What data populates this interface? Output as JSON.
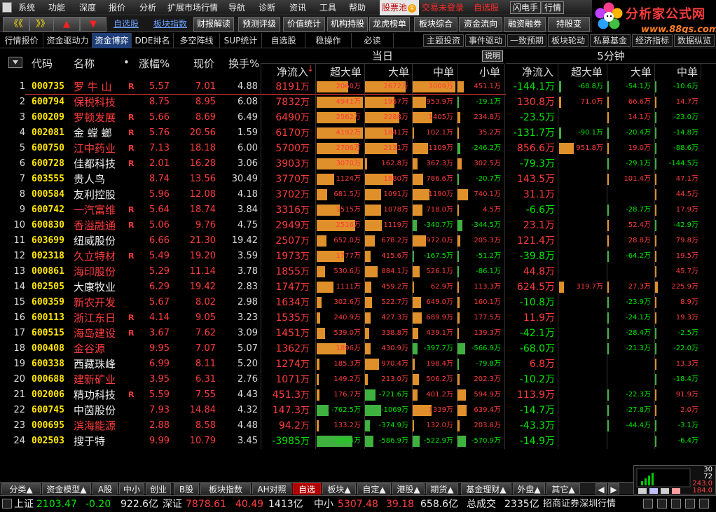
{
  "menubar": {
    "items": [
      "系统",
      "功能",
      "深度",
      "报价",
      "分析",
      "扩展市场行情",
      "导航",
      "诊断",
      "资讯",
      "工具",
      "帮助"
    ],
    "stock_pool": "股票池",
    "stock_pool_badge": "①",
    "login_prompt": "交易未登录",
    "self_select": "自选股",
    "flash_btn": "闪电手",
    "quote_btn": "行情"
  },
  "toolbar": {
    "back": "《《",
    "forward": "》》",
    "up": "▲",
    "down": "▼",
    "links": [
      "自选股",
      "板块指数"
    ],
    "buttons": [
      "财报解读",
      "预测评级",
      "价值统计",
      "机构持股",
      "龙虎榜单",
      "板块综合",
      "资金流向",
      "融资融券",
      "持股变"
    ]
  },
  "logo": {
    "title": "分析家公式网",
    "url": "www.88gs.com"
  },
  "subtabs": {
    "left": [
      "行情报价",
      "资金驱动力",
      "资金博弈",
      "DDE排名",
      "多空阵线",
      "SUP统计",
      "自选股",
      "稳操作",
      "必读"
    ],
    "right": [
      "主题投资",
      "事件驱动",
      "一致预期",
      "板块轮动",
      "私募基金",
      "经济指标",
      "数据纵览"
    ]
  },
  "table_header": {
    "code": "代码",
    "name": "名称",
    "name_dot": "•",
    "change": "涨幅%",
    "price": "现价",
    "turnover": "换手%",
    "group_today": "当日",
    "explain": "说明",
    "group_5min": "5分钟",
    "today_cols": [
      "净流入",
      "超大单",
      "大单",
      "中单",
      "小单"
    ],
    "min_cols": [
      "净流入",
      "超大单",
      "大单",
      "中单"
    ]
  },
  "colors": {
    "up": "#ff3c3c",
    "down": "#00e600",
    "code": "#ffe600",
    "bar_up": "#e0902a",
    "bar_down": "#3fb13f"
  },
  "rows": [
    {
      "idx": "1",
      "code": "000735",
      "name": "罗 牛 山",
      "name_red": true,
      "flag": "R",
      "chg": "5.57",
      "price": "7.01",
      "turn": "4.88",
      "net": "8191",
      "net_unit": "万",
      "t1": "2060万",
      "t2": "2672万",
      "t3": "3009万",
      "t4": "451.1万",
      "net5": "-144.1万",
      "m1": "-68.8万",
      "m2": "-54.1万",
      "m3": "-10.6万"
    },
    {
      "idx": "2",
      "code": "600794",
      "name": "保税科技",
      "name_red": true,
      "flag": "",
      "chg": "8.75",
      "price": "8.95",
      "turn": "6.08",
      "net": "7832",
      "net_unit": "万",
      "t1": "4941万",
      "t2": "1957万",
      "t3": "953.9万",
      "t4": "-19.1万",
      "net5": "130.8万",
      "m1": "71.0万",
      "m2": "66.6万",
      "m3": "14.7万"
    },
    {
      "idx": "3",
      "code": "600209",
      "name": "罗顿发展",
      "name_red": true,
      "flag": "R",
      "chg": "5.66",
      "price": "8.69",
      "turn": "6.49",
      "net": "6490",
      "net_unit": "万",
      "t1": "2562万",
      "t2": "2288万",
      "t3": "1405万",
      "t4": "234.8万",
      "net5": "-23.5万",
      "m1": "",
      "m2": "14.1万",
      "m3": "-23.0万"
    },
    {
      "idx": "4",
      "code": "002081",
      "name": "金 螳 螂",
      "name_red": false,
      "flag": "R",
      "chg": "5.76",
      "price": "20.56",
      "turn": "1.59",
      "net": "6170",
      "net_unit": "万",
      "t1": "4192万",
      "t2": "1841万",
      "t3": "102.1万",
      "t4": "35.2万",
      "net5": "-131.7万",
      "m1": "-90.1万",
      "m2": "-20.4万",
      "m3": "-14.8万"
    },
    {
      "idx": "5",
      "code": "600750",
      "name": "江中药业",
      "name_red": true,
      "flag": "R",
      "chg": "7.13",
      "price": "18.18",
      "turn": "6.00",
      "net": "5700",
      "net_unit": "万",
      "t1": "2706万",
      "t2": "2131万",
      "t3": "1109万",
      "t4": "-246.2万",
      "net5": "856.6万",
      "m1": "951.8万",
      "m2": "19.0万",
      "m3": "-88.6万"
    },
    {
      "idx": "6",
      "code": "600728",
      "name": "佳都科技",
      "name_red": false,
      "flag": "R",
      "chg": "2.01",
      "price": "16.28",
      "turn": "3.06",
      "net": "3903",
      "net_unit": "万",
      "t1": "3070万",
      "t2": "162.8万",
      "t3": "367.3万",
      "t4": "302.5万",
      "net5": "-79.3万",
      "m1": "",
      "m2": "-29.1万",
      "m3": "-144.5万"
    },
    {
      "idx": "7",
      "code": "603555",
      "name": "贵人鸟",
      "name_red": false,
      "flag": "",
      "chg": "8.74",
      "price": "13.56",
      "turn": "30.49",
      "net": "3770",
      "net_unit": "万",
      "t1": "1124万",
      "t2": "1880万",
      "t3": "786.6万",
      "t4": "-20.7万",
      "net5": "143.5万",
      "m1": "",
      "m2": "101.4万",
      "m3": "47.1万"
    },
    {
      "idx": "8",
      "code": "000584",
      "name": "友利控股",
      "name_red": false,
      "flag": "",
      "chg": "5.96",
      "price": "12.08",
      "turn": "4.18",
      "net": "3702",
      "net_unit": "万",
      "t1": "681.5万",
      "t2": "1091万",
      "t3": "1190万",
      "t4": "740.1万",
      "net5": "31.1万",
      "m1": "",
      "m2": "",
      "m3": "44.5万"
    },
    {
      "idx": "9",
      "code": "600742",
      "name": "一汽富维",
      "name_red": true,
      "flag": "R",
      "chg": "5.64",
      "price": "18.74",
      "turn": "3.84",
      "net": "3316",
      "net_unit": "万",
      "t1": "1515万",
      "t2": "1078万",
      "t3": "718.0万",
      "t4": "4.5万",
      "net5": "-6.6万",
      "m1": "",
      "m2": "-28.7万",
      "m3": "17.9万"
    },
    {
      "idx": "10",
      "code": "600830",
      "name": "香溢融通",
      "name_red": true,
      "flag": "R",
      "chg": "5.06",
      "price": "9.76",
      "turn": "4.75",
      "net": "2949",
      "net_unit": "万",
      "t1": "2516万",
      "t2": "1119万",
      "t3": "-340.7万",
      "t4": "-344.5万",
      "net5": "23.1万",
      "m1": "",
      "m2": "52.4万",
      "m3": "-42.9万"
    },
    {
      "idx": "11",
      "code": "603699",
      "name": "纽威股份",
      "name_red": false,
      "flag": "",
      "chg": "6.66",
      "price": "21.30",
      "turn": "19.42",
      "net": "2507",
      "net_unit": "万",
      "t1": "652.0万",
      "t2": "678.2万",
      "t3": "972.0万",
      "t4": "205.3万",
      "net5": "121.4万",
      "m1": "",
      "m2": "28.8万",
      "m3": "79.8万"
    },
    {
      "idx": "12",
      "code": "002318",
      "name": "久立特材",
      "name_red": true,
      "flag": "R",
      "chg": "5.49",
      "price": "19.20",
      "turn": "3.59",
      "net": "1973",
      "net_unit": "万",
      "t1": "1777万",
      "t2": "415.6万",
      "t3": "-167.5万",
      "t4": "-51.2万",
      "net5": "-39.8万",
      "m1": "",
      "m2": "-64.2万",
      "m3": "19.5万"
    },
    {
      "idx": "13",
      "code": "000861",
      "name": "海印股份",
      "name_red": true,
      "flag": "",
      "chg": "5.29",
      "price": "11.14",
      "turn": "3.78",
      "net": "1855",
      "net_unit": "万",
      "t1": "530.6万",
      "t2": "884.1万",
      "t3": "526.1万",
      "t4": "-86.1万",
      "net5": "44.8万",
      "m1": "",
      "m2": "",
      "m3": "45.7万"
    },
    {
      "idx": "14",
      "code": "002505",
      "name": "大康牧业",
      "name_red": false,
      "flag": "",
      "chg": "6.29",
      "price": "19.42",
      "turn": "2.83",
      "net": "1747",
      "net_unit": "万",
      "t1": "1111万",
      "t2": "459.2万",
      "t3": "62.9万",
      "t4": "113.3万",
      "net5": "624.5万",
      "m1": "319.7万",
      "m2": "27.3万",
      "m3": "225.9万"
    },
    {
      "idx": "15",
      "code": "600359",
      "name": "新农开发",
      "name_red": true,
      "flag": "",
      "chg": "5.67",
      "price": "8.02",
      "turn": "2.98",
      "net": "1634",
      "net_unit": "万",
      "t1": "302.6万",
      "t2": "522.7万",
      "t3": "649.0万",
      "t4": "160.1万",
      "net5": "-10.8万",
      "m1": "",
      "m2": "-23.9万",
      "m3": "8.9万"
    },
    {
      "idx": "16",
      "code": "600113",
      "name": "浙江东日",
      "name_red": true,
      "flag": "R",
      "chg": "4.14",
      "price": "9.05",
      "turn": "3.23",
      "net": "1535",
      "net_unit": "万",
      "t1": "240.9万",
      "t2": "427.3万",
      "t3": "689.9万",
      "t4": "177.5万",
      "net5": "11.9万",
      "m1": "",
      "m2": "-24.1万",
      "m3": "19.3万"
    },
    {
      "idx": "17",
      "code": "600515",
      "name": "海岛建设",
      "name_red": true,
      "flag": "R",
      "chg": "3.67",
      "price": "7.62",
      "turn": "3.09",
      "net": "1451",
      "net_unit": "万",
      "t1": "539.0万",
      "t2": "338.8万",
      "t3": "439.1万",
      "t4": "139.3万",
      "net5": "-42.1万",
      "m1": "",
      "m2": "-28.4万",
      "m3": "-2.5万"
    },
    {
      "idx": "18",
      "code": "000408",
      "name": "金谷源",
      "name_red": true,
      "flag": "",
      "chg": "9.95",
      "price": "7.07",
      "turn": "5.07",
      "net": "1362",
      "net_unit": "万",
      "t1": "1896万",
      "t2": "430.9万",
      "t3": "-397.7万",
      "t4": "-566.9万",
      "net5": "-68.0万",
      "m1": "",
      "m2": "-21.3万",
      "m3": "-22.0万"
    },
    {
      "idx": "19",
      "code": "600338",
      "name": "西藏珠峰",
      "name_red": false,
      "flag": "",
      "chg": "6.99",
      "price": "8.11",
      "turn": "5.20",
      "net": "1274",
      "net_unit": "万",
      "t1": "185.3万",
      "t2": "970.4万",
      "t3": "198.4万",
      "t4": "-79.8万",
      "net5": "6.8万",
      "m1": "",
      "m2": "",
      "m3": "13.3万"
    },
    {
      "idx": "20",
      "code": "000688",
      "name": "建新矿业",
      "name_red": true,
      "flag": "",
      "chg": "3.95",
      "price": "6.31",
      "turn": "2.76",
      "net": "1071",
      "net_unit": "万",
      "t1": "149.2万",
      "t2": "213.0万",
      "t3": "506.2万",
      "t4": "202.3万",
      "net5": "-10.2万",
      "m1": "",
      "m2": "",
      "m3": "-18.4万"
    },
    {
      "idx": "21",
      "code": "002006",
      "name": "精功科技",
      "name_red": false,
      "flag": "R",
      "chg": "5.59",
      "price": "7.55",
      "turn": "4.43",
      "net": "451.3",
      "net_unit": "万",
      "t1": "176.7万",
      "t2": "-721.6万",
      "t3": "401.2万",
      "t4": "594.9万",
      "net5": "113.9万",
      "m1": "",
      "m2": "-22.3万",
      "m3": "91.9万"
    },
    {
      "idx": "22",
      "code": "600745",
      "name": "中茵股份",
      "name_red": false,
      "flag": "",
      "chg": "7.93",
      "price": "14.84",
      "turn": "4.32",
      "net": "147.3",
      "net_unit": "万",
      "t1": "-762.5万",
      "t2": "-1069万",
      "t3": "1339万",
      "t4": "639.4万",
      "net5": "-14.7万",
      "m1": "",
      "m2": "-27.8万",
      "m3": "2.0万"
    },
    {
      "idx": "23",
      "code": "000695",
      "name": "滨海能源",
      "name_red": true,
      "flag": "",
      "chg": "2.88",
      "price": "8.58",
      "turn": "4.48",
      "net": "94.2",
      "net_unit": "万",
      "t1": "133.2万",
      "t2": "-374.9万",
      "t3": "132.0万",
      "t4": "203.8万",
      "net5": "-43.3万",
      "m1": "",
      "m2": "-44.4万",
      "m3": "-3.1万"
    },
    {
      "idx": "24",
      "code": "002503",
      "name": "搜于特",
      "name_red": false,
      "flag": "",
      "chg": "9.99",
      "price": "10.79",
      "turn": "3.45",
      "net": "-3985",
      "net_unit": "万",
      "t1": "-2304万",
      "t2": "-586.9万",
      "t3": "-522.9万",
      "t4": "-570.9万",
      "net5": "-14.9万",
      "m1": "",
      "m2": "",
      "m3": "-6.4万"
    }
  ],
  "bottom_tabs": [
    "分类▲",
    "资金模型▲",
    "A股",
    "中小",
    "创业",
    "B股",
    "板块指数",
    "AH对照",
    "自选",
    "板块▲",
    "自定▲",
    "港股▲",
    "期货▲",
    "基金理财▲",
    "外盘▲",
    "其它▲"
  ],
  "bottom_active": "自选",
  "widget": {
    "v1": "30",
    "v2": "72",
    "v3": "243.0",
    "v4": "184.0"
  },
  "status": {
    "sh_label": "上证",
    "sh_index": "2103.47",
    "sh_change": "-0.20",
    "sh_amount": "922.6亿",
    "sz_label": "深证",
    "sz_index": "7878.61",
    "sz_change": "40.49",
    "sz_amount": "1413亿",
    "sme_label": "中小",
    "sme_index": "5307.48",
    "sme_change": "39.18",
    "sme_amount": "658.6亿",
    "total_label": "总成交",
    "total_amount": "2335亿",
    "broker": "招商证券深圳行情"
  }
}
